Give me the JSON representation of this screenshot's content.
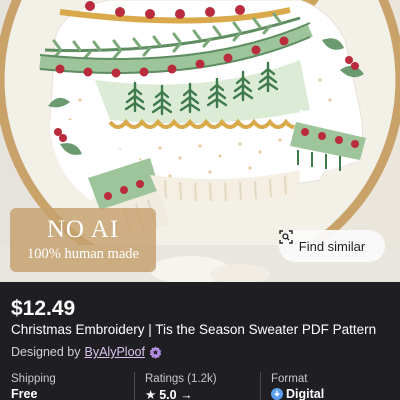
{
  "listing_image": {
    "overlay_title": "NO AI",
    "overlay_subtitle": "100% human made",
    "find_similar_label": "Find similar"
  },
  "listing": {
    "price": "$12.49",
    "title": "Christmas Embroidery | Tis the Season Sweater PDF Pattern",
    "designer_prefix": "Designed by",
    "designer_name": "ByAlyPloof"
  },
  "info": [
    {
      "label": "Shipping",
      "value": "Free"
    },
    {
      "label": "Ratings (1.2k)",
      "value": "5.0 →",
      "icon": "star-icon"
    },
    {
      "label": "Format",
      "value": "Digital",
      "icon": "digital-icon"
    }
  ],
  "colors": {
    "sheet_background": "#1f1f23",
    "designer_link": "#d8c4ee",
    "badge_background": "#c6a06e",
    "fabric": "#f2efe7",
    "sweater_green": "#6b9a70",
    "sweater_red": "#b92c3e",
    "sweater_gold": "#d9a94a"
  }
}
